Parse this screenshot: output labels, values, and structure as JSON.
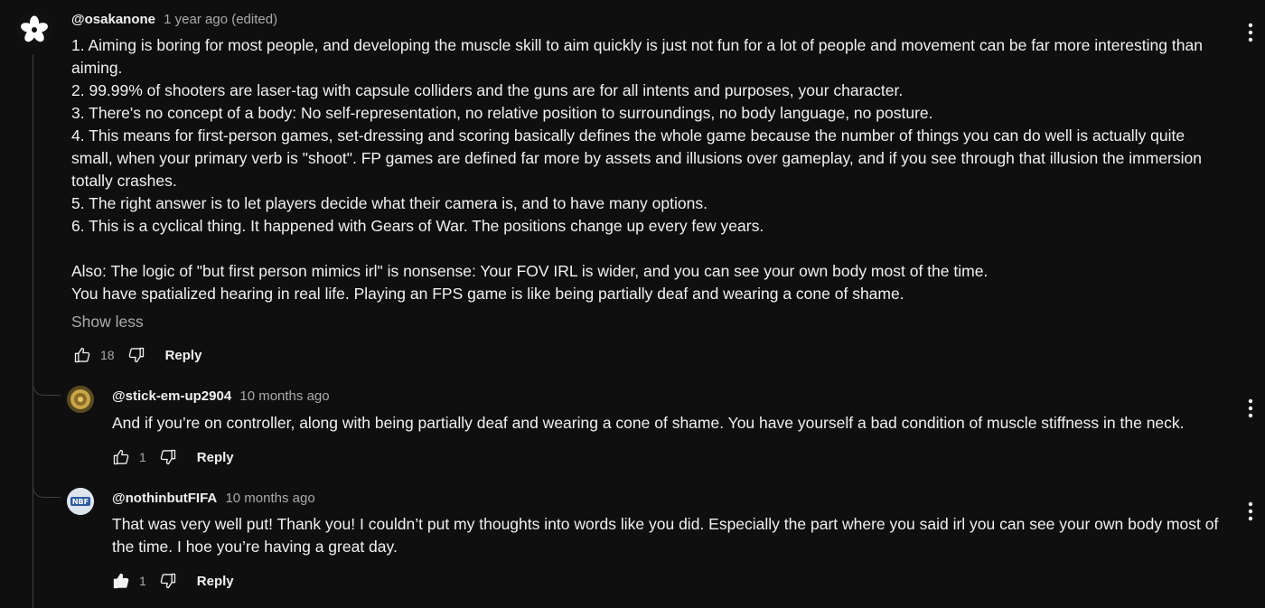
{
  "comment": {
    "author": "@osakanone",
    "timestamp": "1 year ago (edited)",
    "lines": [
      "1. Aiming is boring for most people, and developing the muscle skill to aim quickly is just not fun for a lot of people and movement can be far more interesting than aiming.",
      "2. 99.99% of shooters are laser-tag with capsule colliders and the guns are for all intents and purposes, your character.",
      "3. There's no concept of a body: No self-representation, no relative position to surroundings, no body language, no posture.",
      "4. This means for first-person games, set-dressing and scoring basically defines the whole game because the number of things you can do well is actually quite small, when your primary verb is \"shoot\". FP games are defined far more by assets and illusions over gameplay, and if you see through that illusion the immersion totally crashes.",
      "5. The right answer is to let players decide what their camera is, and to have many options.",
      "6. This is a cyclical thing. It happened with Gears of War. The positions change up every few years.",
      "",
      "Also: The logic of \"but first person mimics irl\" is nonsense: Your FOV IRL is wider, and you can see your own body most of the time.",
      "You have spatialized hearing in real life. Playing an FPS game is like being partially deaf and wearing a cone of shame."
    ],
    "show_less": "Show less",
    "likes": "18",
    "reply_label": "Reply"
  },
  "replies": [
    {
      "author": "@stick-em-up2904",
      "timestamp": "10 months ago",
      "text": "And if you’re on controller, along with being partially deaf and wearing a cone of shame. You have yourself a bad condition of muscle stiffness in the neck.",
      "likes": "1",
      "reply_label": "Reply",
      "liked": false
    },
    {
      "author": "@nothinbutFIFA",
      "timestamp": "10 months ago",
      "avatar_text": "NBF",
      "text": "That was very well put! Thank you! I couldn’t put my thoughts into words like you did. Especially the part where you said irl you can see your own body most of the time. I hoe you’re having a great day.",
      "likes": "1",
      "reply_label": "Reply",
      "liked": true
    }
  ],
  "colors": {
    "background": "#0f0f0f",
    "text": "#f1f1f1",
    "secondary": "#aaaaaa"
  }
}
